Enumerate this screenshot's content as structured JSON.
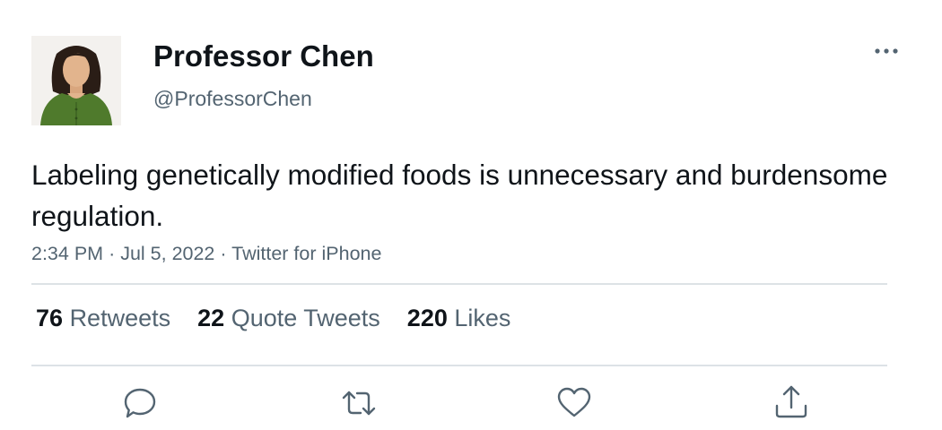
{
  "author": {
    "display_name": "Professor Chen",
    "handle": "@ProfessorChen"
  },
  "tweet": {
    "text": "Labeling genetically modified foods is unnecessary and burdensome regulation.",
    "time": "2:34 PM",
    "date": "Jul 5, 2022",
    "source": "Twitter for iPhone"
  },
  "stats": {
    "retweets_count": "76",
    "retweets_label": "Retweets",
    "quotes_count": "22",
    "quotes_label": "Quote Tweets",
    "likes_count": "220",
    "likes_label": "Likes"
  },
  "colors": {
    "text_primary": "#0f1419",
    "text_secondary": "#536471",
    "divider": "#dde2e6",
    "icon": "#536471"
  },
  "icons": {
    "more": "more-horizontal-icon",
    "reply": "reply-icon",
    "retweet": "retweet-icon",
    "like": "heart-icon",
    "share": "share-icon"
  }
}
